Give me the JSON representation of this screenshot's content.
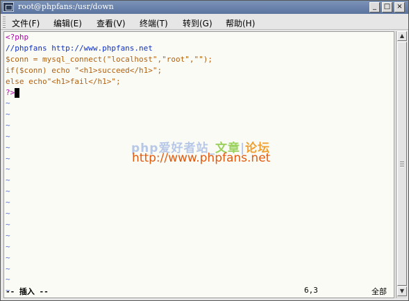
{
  "window": {
    "title": "root@phpfans:/usr/down"
  },
  "menu": [
    {
      "label": "文件(F)"
    },
    {
      "label": "编辑(E)"
    },
    {
      "label": "查看(V)"
    },
    {
      "label": "终端(T)"
    },
    {
      "label": "转到(G)"
    },
    {
      "label": "帮助(H)"
    }
  ],
  "code": [
    {
      "text": "<?php",
      "color": "#b000b0"
    },
    {
      "text": "//phpfans http://www.phpfans.net",
      "color": "#1030c0"
    },
    {
      "text": "$conn = mysql_connect(\"localhost\",\"root\",\"\");",
      "color": "#b06010"
    },
    {
      "text": "if($conn) echo \"<h1>succeed</h1>\";",
      "color": "#b06010"
    },
    {
      "text": "else echo\"<h1>fail</h1>\";",
      "color": "#b06010"
    },
    {
      "text": "?>",
      "color": "#b000b0"
    }
  ],
  "tilde": "~",
  "tilde_count": 18,
  "status": {
    "mode": "-- 插入 --",
    "position": "6,3",
    "scope": "全部"
  },
  "watermark": {
    "line1_a": "php爱好者站_",
    "line1_b": "文章",
    "line1_sep": "|",
    "line1_c": "论坛",
    "line2": "http://www.phpfans.net"
  }
}
